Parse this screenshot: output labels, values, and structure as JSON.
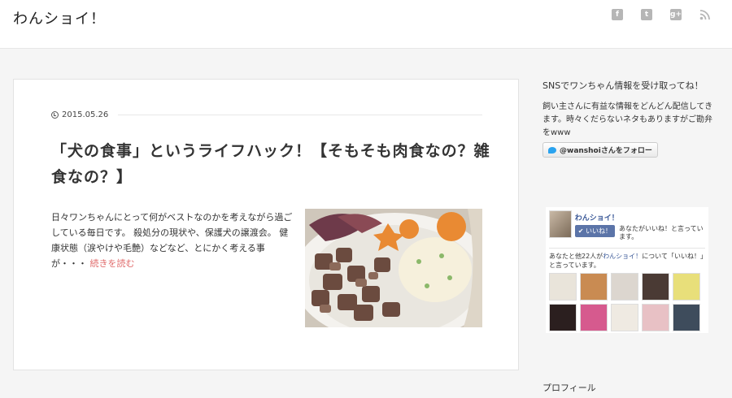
{
  "site": {
    "title": "わんショイ！"
  },
  "header": {
    "social_icons": [
      "facebook-icon",
      "twitter-icon",
      "google-plus-icon",
      "rss-icon"
    ]
  },
  "post": {
    "date": "2015.05.26",
    "title": "「犬の食事」というライフハック！【そもそも肉食なの？雑食なの？】",
    "excerpt": "日々ワンちゃんにとって何がベストなのかを考えながら過ごしている毎日です。 殺処分の現状や、保護犬の譲渡会。 健康状態（涙やけや毛艶）などなど、とにかく考える事が・・・",
    "more_link": "続きを読む"
  },
  "sidebar": {
    "sns_title": "SNSでワンちゃん情報を受け取ってね！",
    "sns_text": "飼い主さんに有益な情報をどんどん配信してきます。時々くだらないネタもありますがご勘弁をwww",
    "follow_button": "@wanshoiさんをフォロー",
    "fb": {
      "page_name": "わんショイ！",
      "like_button": "✔ いいね！",
      "like_note": "あなたがいいね！と言っています。",
      "count_prefix": "あなたと他22人が",
      "count_link": "わんショイ！",
      "count_suffix": "について「いいね！」と言っています。",
      "face_colors": [
        "#e9e4da",
        "#c98b52",
        "#dcd6cf",
        "#4a3a34",
        "#e8df7a",
        "#2b1f1f",
        "#d65a8e",
        "#efeae2",
        "#e8c1c5",
        "#3e4c5c"
      ]
    },
    "profile_title": "プロフィール"
  },
  "colors": {
    "accent_link": "#e06a6a",
    "fb_blue": "#3b5998",
    "twitter_blue": "#2aa3ef"
  }
}
